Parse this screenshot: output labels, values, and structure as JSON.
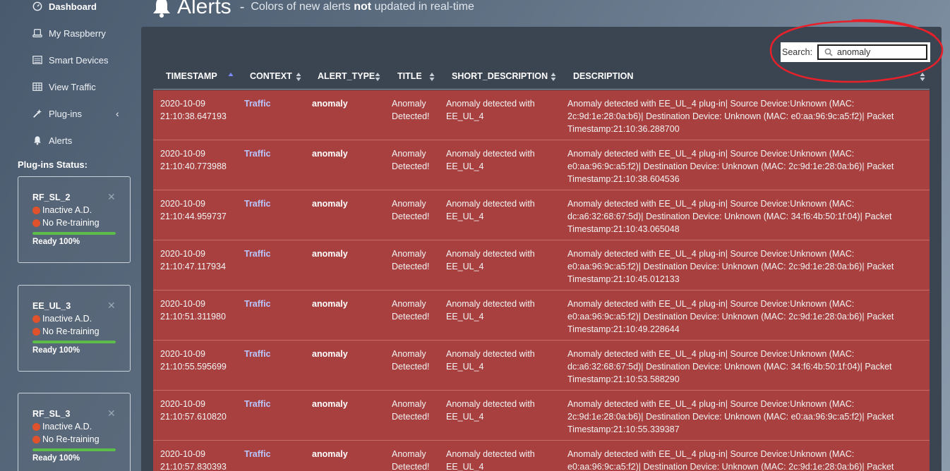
{
  "nav": {
    "items": [
      {
        "label": "Dashboard",
        "icon": "dashboard-icon"
      },
      {
        "label": "My Raspberry",
        "icon": "device-icon"
      },
      {
        "label": "Smart Devices",
        "icon": "list-icon"
      },
      {
        "label": "View Traffic",
        "icon": "table-icon"
      },
      {
        "label": "Plug-ins",
        "icon": "wand-icon"
      },
      {
        "label": "Alerts",
        "icon": "bell-icon"
      }
    ],
    "plugins_heading": "Plug-ins Status:"
  },
  "plugins": [
    {
      "name": "RF_SL_2",
      "status1": "Inactive A.D.",
      "status2": "No Re-training",
      "ready": "Ready 100%",
      "progress": 1.0
    },
    {
      "name": "EE_UL_3",
      "status1": "Inactive A.D.",
      "status2": "No Re-training",
      "ready": "Ready 100%",
      "progress": 1.0
    },
    {
      "name": "RF_SL_3",
      "status1": "Inactive A.D.",
      "status2": "No Re-training",
      "ready": "Ready 100%",
      "progress": 1.0
    }
  ],
  "header": {
    "title": "Alerts",
    "separator": "-",
    "subtitle_pre": "Colors of new alerts",
    "subtitle_bold": "not",
    "subtitle_post": "updated in real-time"
  },
  "search": {
    "label": "Search:",
    "value": "anomaly"
  },
  "columns": [
    "TIMESTAMP",
    "CONTEXT",
    "ALERT_TYPE",
    "TITLE",
    "SHORT_DESCRIPTION",
    "DESCRIPTION"
  ],
  "rows": [
    {
      "date": "2020-10-09",
      "time": "21:10:38.647193",
      "context": "Traffic",
      "type": "anomaly",
      "title1": "Anomaly",
      "title2": "Detected!",
      "short1": "Anomaly detected with",
      "short2": "EE_UL_4",
      "desc1": "Anomaly detected with EE_UL_4 plug-in| Source Device:Unknown (MAC:",
      "desc2": "2c:9d:1e:28:0a:b6)| Destination Device: Unknown (MAC: e0:aa:96:9c:a5:f2)| Packet",
      "desc3": "Timestamp:21:10:36.288700"
    },
    {
      "date": "2020-10-09",
      "time": "21:10:40.773988",
      "context": "Traffic",
      "type": "anomaly",
      "title1": "Anomaly",
      "title2": "Detected!",
      "short1": "Anomaly detected with",
      "short2": "EE_UL_4",
      "desc1": "Anomaly detected with EE_UL_4 plug-in| Source Device:Unknown (MAC:",
      "desc2": "e0:aa:96:9c:a5:f2)| Destination Device: Unknown (MAC: 2c:9d:1e:28:0a:b6)| Packet",
      "desc3": "Timestamp:21:10:38.604536"
    },
    {
      "date": "2020-10-09",
      "time": "21:10:44.959737",
      "context": "Traffic",
      "type": "anomaly",
      "title1": "Anomaly",
      "title2": "Detected!",
      "short1": "Anomaly detected with",
      "short2": "EE_UL_4",
      "desc1": "Anomaly detected with EE_UL_4 plug-in| Source Device:Unknown (MAC:",
      "desc2": "dc:a6:32:68:67:5d)| Destination Device: Unknown (MAC: 34:f6:4b:50:1f:04)| Packet",
      "desc3": "Timestamp:21:10:43.065048"
    },
    {
      "date": "2020-10-09",
      "time": "21:10:47.117934",
      "context": "Traffic",
      "type": "anomaly",
      "title1": "Anomaly",
      "title2": "Detected!",
      "short1": "Anomaly detected with",
      "short2": "EE_UL_4",
      "desc1": "Anomaly detected with EE_UL_4 plug-in| Source Device:Unknown (MAC:",
      "desc2": "e0:aa:96:9c:a5:f2)| Destination Device: Unknown (MAC: 2c:9d:1e:28:0a:b6)| Packet",
      "desc3": "Timestamp:21:10:45.012133"
    },
    {
      "date": "2020-10-09",
      "time": "21:10:51.311980",
      "context": "Traffic",
      "type": "anomaly",
      "title1": "Anomaly",
      "title2": "Detected!",
      "short1": "Anomaly detected with",
      "short2": "EE_UL_4",
      "desc1": "Anomaly detected with EE_UL_4 plug-in| Source Device:Unknown (MAC:",
      "desc2": "e0:aa:96:9c:a5:f2)| Destination Device: Unknown (MAC: 2c:9d:1e:28:0a:b6)| Packet",
      "desc3": "Timestamp:21:10:49.228644"
    },
    {
      "date": "2020-10-09",
      "time": "21:10:55.595699",
      "context": "Traffic",
      "type": "anomaly",
      "title1": "Anomaly",
      "title2": "Detected!",
      "short1": "Anomaly detected with",
      "short2": "EE_UL_4",
      "desc1": "Anomaly detected with EE_UL_4 plug-in| Source Device:Unknown (MAC:",
      "desc2": "dc:a6:32:68:67:5d)| Destination Device: Unknown (MAC: 34:f6:4b:50:1f:04)| Packet",
      "desc3": "Timestamp:21:10:53.588290"
    },
    {
      "date": "2020-10-09",
      "time": "21:10:57.610820",
      "context": "Traffic",
      "type": "anomaly",
      "title1": "Anomaly",
      "title2": "Detected!",
      "short1": "Anomaly detected with",
      "short2": "EE_UL_4",
      "desc1": "Anomaly detected with EE_UL_4 plug-in| Source Device:Unknown (MAC:",
      "desc2": "2c:9d:1e:28:0a:b6)| Destination Device: Unknown (MAC: e0:aa:96:9c:a5:f2)| Packet",
      "desc3": "Timestamp:21:10:55.339387"
    },
    {
      "date": "2020-10-09",
      "time": "21:10:57.830393",
      "context": "Traffic",
      "type": "anomaly",
      "title1": "Anomaly",
      "title2": "Detected!",
      "short1": "Anomaly detected with",
      "short2": "EE_UL_4",
      "desc1": "Anomaly detected with EE_UL_4 plug-in| Source Device:Unknown (MAC:",
      "desc2": "e0:aa:96:9c:a5:f2)| Destination Device: Unknown (MAC: 2c:9d:1e:28:0a:b6)| Packet",
      "desc3": ""
    }
  ],
  "colors": {
    "row_background": "#a84040",
    "context_link": "#b9c6ff",
    "status_dot": "#e0522b",
    "progress_fill": "#5cbd4b",
    "annotation_circle": "#e8202a"
  }
}
